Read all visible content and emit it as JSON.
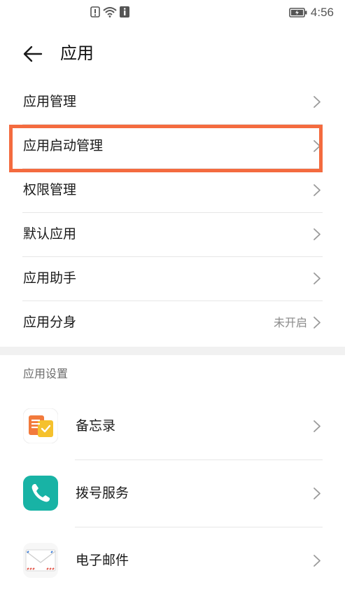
{
  "status_bar": {
    "time": "4:56",
    "icons": [
      "notification-alert-icon",
      "wifi-icon",
      "info-icon",
      "battery-icon"
    ]
  },
  "header": {
    "title": "应用"
  },
  "menu": {
    "items": [
      {
        "label": "应用管理",
        "value": ""
      },
      {
        "label": "应用启动管理",
        "value": ""
      },
      {
        "label": "权限管理",
        "value": ""
      },
      {
        "label": "默认应用",
        "value": ""
      },
      {
        "label": "应用助手",
        "value": ""
      },
      {
        "label": "应用分身",
        "value": "未开启"
      }
    ]
  },
  "settings_section": {
    "title": "应用设置",
    "apps": [
      {
        "label": "备忘录",
        "icon": "memo-app-icon"
      },
      {
        "label": "拨号服务",
        "icon": "phone-app-icon"
      },
      {
        "label": "电子邮件",
        "icon": "email-app-icon"
      }
    ]
  },
  "colors": {
    "highlight": "#f46b3f",
    "divider": "#e6e6e6",
    "section_bg": "#f1f1f1",
    "phone_app": "#18b3a5",
    "memo_orange": "#f27a3c",
    "memo_yellow": "#f5c12d"
  }
}
